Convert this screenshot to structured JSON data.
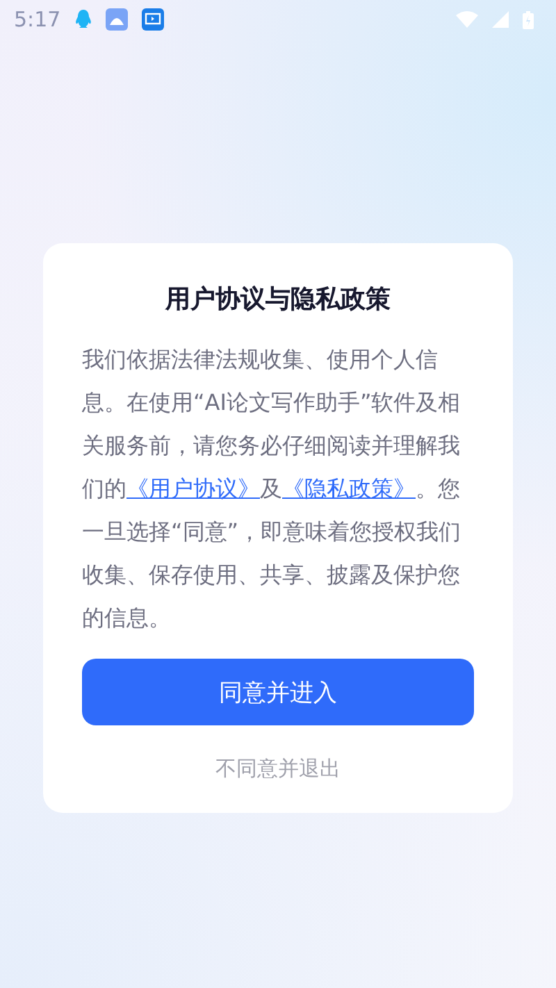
{
  "status_bar": {
    "time": "5:17"
  },
  "dialog": {
    "title": "用户协议与隐私政策",
    "body": [
      {
        "kind": "text",
        "text": "我们依据法律法规收集、使用个人信息。在使用“AI论文写作助手”软件及相关服务前，请您务必仔细阅读并理解我们的"
      },
      {
        "kind": "link",
        "text": "《用户协议》"
      },
      {
        "kind": "text",
        "text": "及"
      },
      {
        "kind": "link",
        "text": "《隐私政策》"
      },
      {
        "kind": "text",
        "text": "。您一旦选择“同意”，即意味着您授权我们收集、保存使用、共享、披露及保护您的信息。"
      }
    ],
    "agree_button": "同意并进入",
    "decline_link": "不同意并退出"
  }
}
